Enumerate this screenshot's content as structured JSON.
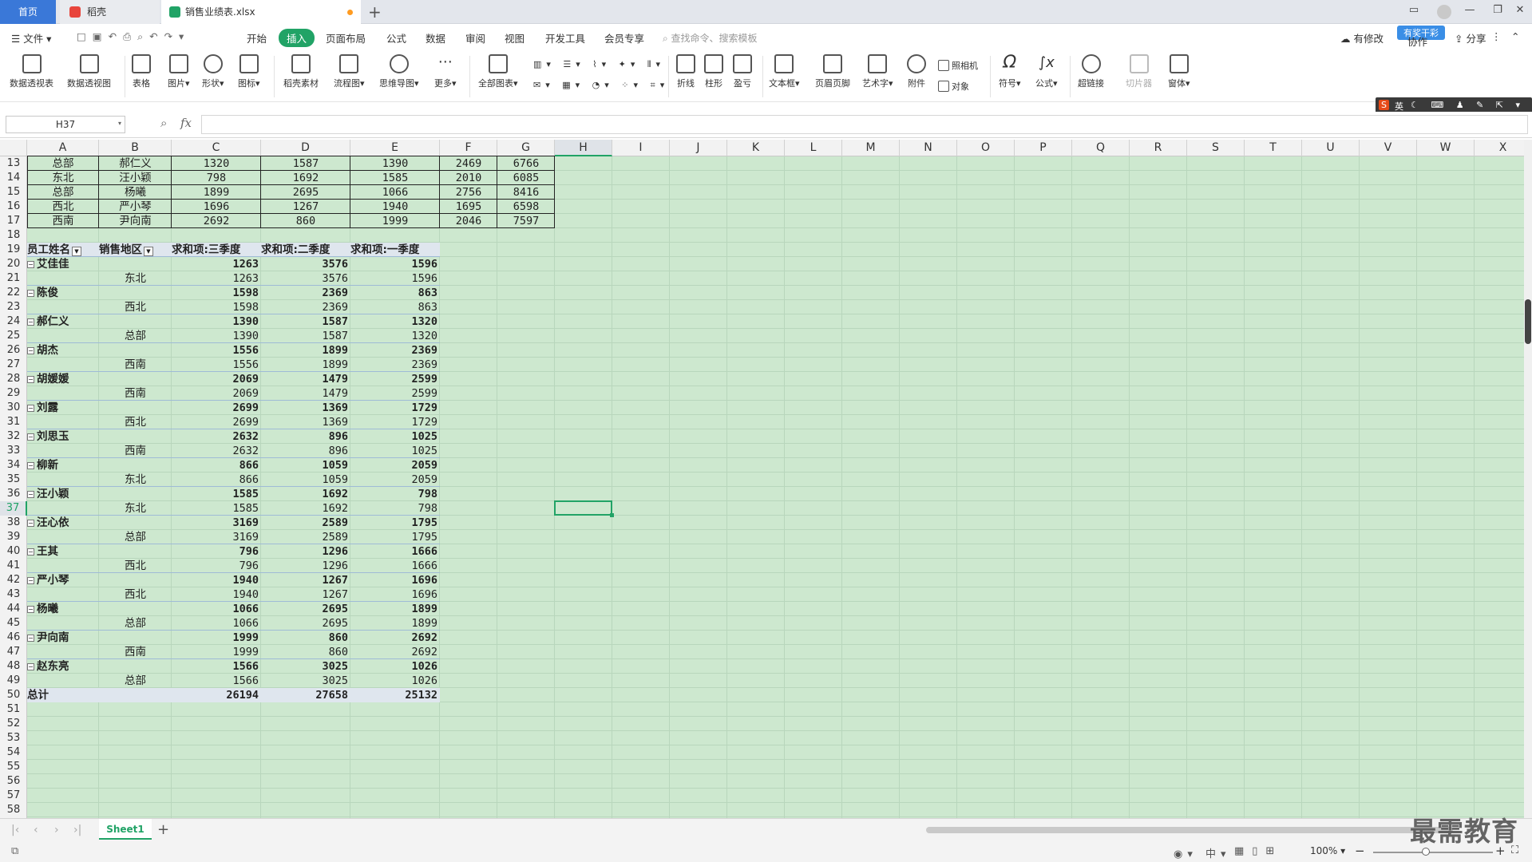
{
  "tabs": {
    "home": "首页",
    "daoke": "稻壳",
    "file": "销售业绩表.xlsx"
  },
  "menu": {
    "file": "文件",
    "items": [
      "开始",
      "插入",
      "页面布局",
      "公式",
      "数据",
      "审阅",
      "视图",
      "开发工具",
      "会员专享"
    ],
    "search": "查找命令、搜索模板",
    "right": [
      "有修改",
      "协作",
      "分享"
    ],
    "badge": "有奖干彩"
  },
  "ribbon": {
    "big": [
      "数据透视表",
      "数据透视图",
      "表格",
      "图片",
      "形状",
      "图标",
      "稻壳素材",
      "流程图",
      "思维导图",
      "更多",
      "全部图表",
      "折线",
      "柱形",
      "盈亏",
      "文本框",
      "页眉页脚",
      "艺术字",
      "附件",
      "符号",
      "公式",
      "超链接",
      "切片器",
      "窗体"
    ],
    "small": [
      "照相机",
      "对象"
    ]
  },
  "ime": "英",
  "formula": {
    "namebox": "H37",
    "fx": "fx",
    "value": ""
  },
  "columns": [
    "A",
    "B",
    "C",
    "D",
    "E",
    "F",
    "G",
    "H",
    "I",
    "J",
    "K",
    "L",
    "M",
    "N",
    "O",
    "P",
    "Q",
    "R",
    "S",
    "T",
    "U",
    "V",
    "W",
    "X"
  ],
  "first_row": 13,
  "table_rows": [
    [
      "总部",
      "郝仁义",
      "1320",
      "1587",
      "1390",
      "2469",
      "6766"
    ],
    [
      "东北",
      "汪小颖",
      "798",
      "1692",
      "1585",
      "2010",
      "6085"
    ],
    [
      "总部",
      "杨曦",
      "1899",
      "2695",
      "1066",
      "2756",
      "8416"
    ],
    [
      "西北",
      "严小琴",
      "1696",
      "1267",
      "1940",
      "1695",
      "6598"
    ],
    [
      "西南",
      "尹向南",
      "2692",
      "860",
      "1999",
      "2046",
      "7597"
    ]
  ],
  "pivot": {
    "headers": [
      "员工姓名",
      "销售地区",
      "求和项:三季度",
      "求和项:二季度",
      "求和项:一季度"
    ],
    "groups": [
      {
        "name": "艾佳佳",
        "region": "东北",
        "v": [
          "1263",
          "3576",
          "1596"
        ]
      },
      {
        "name": "陈俊",
        "region": "西北",
        "v": [
          "1598",
          "2369",
          "863"
        ]
      },
      {
        "name": "郝仁义",
        "region": "总部",
        "v": [
          "1390",
          "1587",
          "1320"
        ]
      },
      {
        "name": "胡杰",
        "region": "西南",
        "v": [
          "1556",
          "1899",
          "2369"
        ]
      },
      {
        "name": "胡媛媛",
        "region": "西南",
        "v": [
          "2069",
          "1479",
          "2599"
        ]
      },
      {
        "name": "刘露",
        "region": "西北",
        "v": [
          "2699",
          "1369",
          "1729"
        ]
      },
      {
        "name": "刘思玉",
        "region": "西南",
        "v": [
          "2632",
          "896",
          "1025"
        ]
      },
      {
        "name": "柳新",
        "region": "东北",
        "v": [
          "866",
          "1059",
          "2059"
        ]
      },
      {
        "name": "汪小颖",
        "region": "东北",
        "v": [
          "1585",
          "1692",
          "798"
        ]
      },
      {
        "name": "汪心依",
        "region": "总部",
        "v": [
          "3169",
          "2589",
          "1795"
        ]
      },
      {
        "name": "王其",
        "region": "西北",
        "v": [
          "796",
          "1296",
          "1666"
        ]
      },
      {
        "name": "严小琴",
        "region": "西北",
        "v": [
          "1940",
          "1267",
          "1696"
        ]
      },
      {
        "name": "杨曦",
        "region": "总部",
        "v": [
          "1066",
          "2695",
          "1899"
        ]
      },
      {
        "name": "尹向南",
        "region": "西南",
        "v": [
          "1999",
          "860",
          "2692"
        ]
      },
      {
        "name": "赵东亮",
        "region": "总部",
        "v": [
          "1566",
          "3025",
          "1026"
        ]
      }
    ],
    "total_label": "总计",
    "totals": [
      "26194",
      "27658",
      "25132"
    ]
  },
  "last_row": 58,
  "sheet": {
    "name": "Sheet1",
    "add": "+"
  },
  "status": {
    "zoom": "100%"
  },
  "watermark": "最需教育"
}
